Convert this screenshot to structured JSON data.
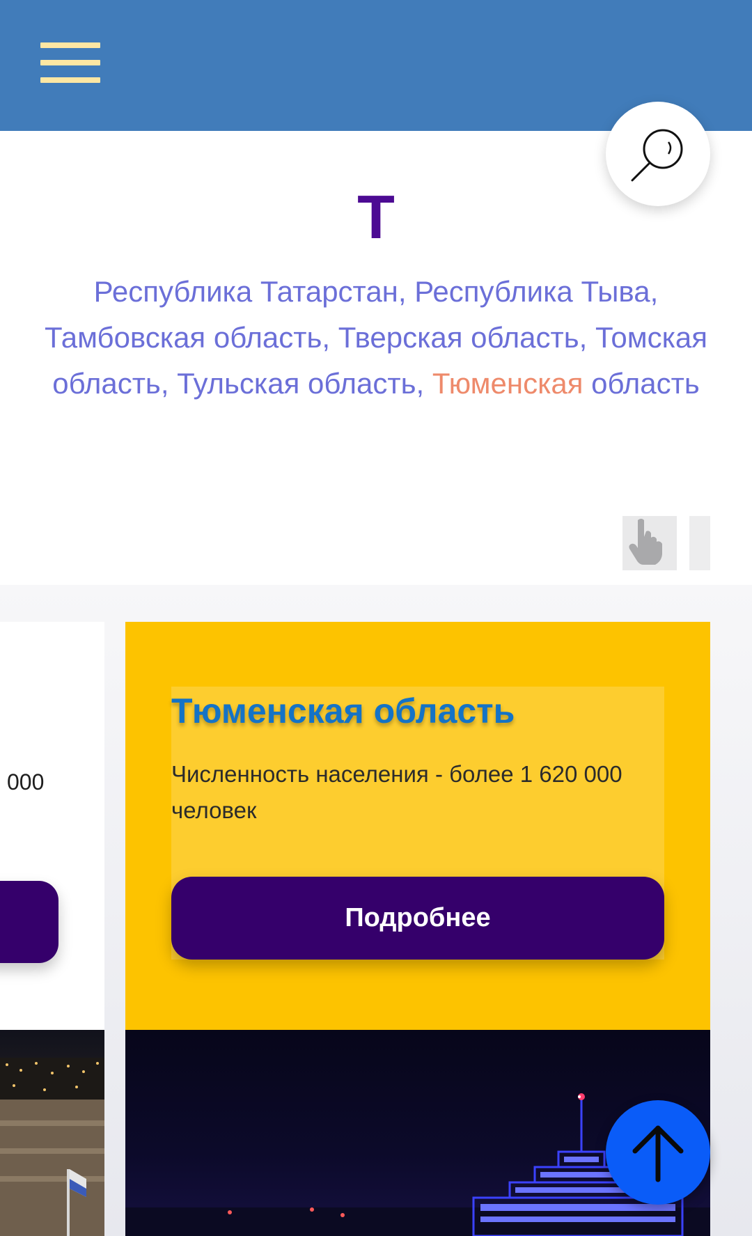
{
  "header": {
    "background_color": "#417cba",
    "menu_icon": "hamburger-menu-icon",
    "search_icon": "magnifier-icon"
  },
  "section": {
    "letter": "Т",
    "regions": [
      {
        "label": "Республика Татарстан",
        "sep": ", ",
        "active": false
      },
      {
        "label": "Республика Тыва",
        "sep": ", ",
        "active": false
      },
      {
        "label": "Тамбовская область",
        "sep": ", ",
        "active": false
      },
      {
        "label": "Тверская область",
        "sep": ", ",
        "active": false
      },
      {
        "label": "Томская область",
        "sep": ", ",
        "active": false
      },
      {
        "label": "Тульская область",
        "sep": ", ",
        "active": false
      },
      {
        "label_highlight": "Тюменская",
        "label_rest": " область",
        "active": true
      }
    ]
  },
  "swipe_hint": {
    "icon": "hand-pointer-icon"
  },
  "prev_card": {
    "population_fragment": "000"
  },
  "card": {
    "title": "Тюменская область",
    "population": "Численность населения - более 1 620 000 человек",
    "more_label": "Подробнее"
  },
  "scroll_top": {
    "icon": "arrow-up-icon"
  },
  "colors": {
    "accent_purple": "#35006b",
    "card_yellow": "#fdc300",
    "title_blue": "#1473c6",
    "link_color": "#6b6fd8",
    "active_link": "#ee8a6b",
    "letter_color": "#4c0a93",
    "scroll_button": "#0a5cf8"
  }
}
